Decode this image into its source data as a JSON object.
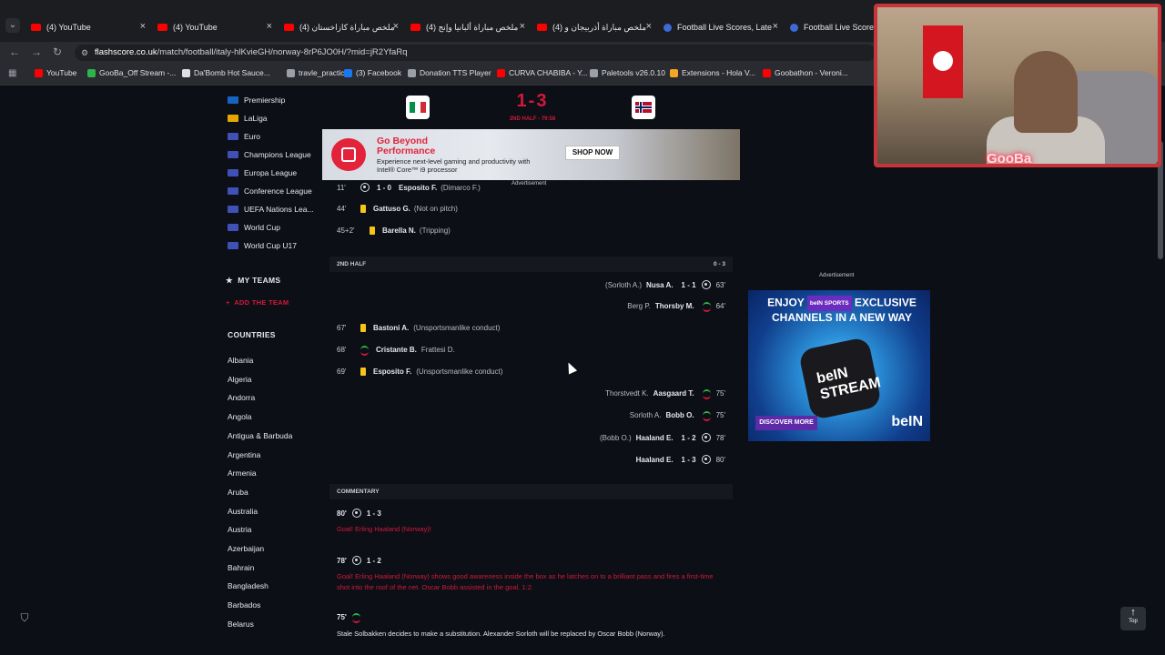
{
  "browser": {
    "tabs": [
      {
        "label": "(4) YouTube",
        "kind": "youtube"
      },
      {
        "label": "(4) YouTube",
        "kind": "youtube"
      },
      {
        "label": "(4) ملخص مباراة كازاخستان",
        "kind": "youtube"
      },
      {
        "label": "(4) ملخص مباراة ألبانيا وإنج",
        "kind": "youtube"
      },
      {
        "label": "(4) ملخص مباراة أذربيجان و",
        "kind": "youtube"
      },
      {
        "label": "Football Live Scores, Late",
        "kind": "flashscore"
      },
      {
        "label": "Football Live Scores, L",
        "kind": "flashscore"
      }
    ],
    "url_host": "flashscore.co.uk",
    "url_path": "/match/football/italy-hlKvieGH/norway-8rP6JO0H/?mid=jR2YfaRq",
    "bookmarks": [
      {
        "label": "YouTube",
        "color": "#ff0000"
      },
      {
        "label": "GooBa_Off Stream -...",
        "color": "#2db34a"
      },
      {
        "label": "Da'Bomb Hot Sauce...",
        "color": "#e0e0e0"
      },
      {
        "label": "travle_practice",
        "color": "#9aa0a6"
      },
      {
        "label": "(3) Facebook",
        "color": "#1877f2"
      },
      {
        "label": "Donation TTS Player",
        "color": "#9aa0a6"
      },
      {
        "label": "CURVA CHABIBA - Y...",
        "color": "#ff0000"
      },
      {
        "label": "Paletools v26.0.10",
        "color": "#9aa0a6"
      },
      {
        "label": "Extensions - Hola V...",
        "color": "#f5a623"
      },
      {
        "label": "Goobathon - Veroni...",
        "color": "#ff0000"
      }
    ]
  },
  "sidebar": {
    "leagues": [
      {
        "label": "Premiership",
        "flag": "#1565c0"
      },
      {
        "label": "LaLiga",
        "flag": "#e6a800"
      },
      {
        "label": "Euro",
        "flag": "#3f51b5"
      },
      {
        "label": "Champions League",
        "flag": "#3f51b5"
      },
      {
        "label": "Europa League",
        "flag": "#3f51b5"
      },
      {
        "label": "Conference League",
        "flag": "#3f51b5"
      },
      {
        "label": "UEFA Nations Lea...",
        "flag": "#3f51b5"
      },
      {
        "label": "World Cup",
        "flag": "#3f51b5"
      },
      {
        "label": "World Cup U17",
        "flag": "#3f51b5"
      }
    ],
    "my_teams_label": "MY TEAMS",
    "add_team_label": "ADD THE TEAM",
    "countries_label": "COUNTRIES",
    "countries": [
      "Albania",
      "Algeria",
      "Andorra",
      "Angola",
      "Antigua & Barbuda",
      "Argentina",
      "Armenia",
      "Aruba",
      "Australia",
      "Austria",
      "Azerbaijan",
      "Bahrain",
      "Bangladesh",
      "Barbados",
      "Belarus"
    ]
  },
  "match": {
    "score": "1-3",
    "status": "2ND HALF - 79:58"
  },
  "ad_top": {
    "headline": "Go Beyond Performance",
    "body": "Experience next-level gaming and productivity with Intel® Core™ i9 processor",
    "cta": "SHOP NOW",
    "label": "Advertisement"
  },
  "first_half_events": [
    {
      "minute": "11'",
      "type": "goal",
      "score": "1 - 0",
      "player": "Esposito F.",
      "detail": "(Dimarco F.)"
    },
    {
      "minute": "44'",
      "type": "yellow",
      "player": "Gattuso G.",
      "detail": "(Not on pitch)"
    },
    {
      "minute": "45+2'",
      "type": "yellow",
      "player": "Barella N.",
      "detail": "(Tripping)"
    }
  ],
  "second_half": {
    "label": "2ND HALF",
    "score": "0 - 3"
  },
  "second_half_events": [
    {
      "side": "away",
      "minute": "63'",
      "type": "goal",
      "score": "1 - 1",
      "player": "Nusa A.",
      "detail": "(Sorloth A.)"
    },
    {
      "side": "away",
      "minute": "64'",
      "type": "sub",
      "player": "Thorsby M.",
      "detail": "Berg P."
    },
    {
      "side": "home",
      "minute": "67'",
      "type": "yellow",
      "player": "Bastoni A.",
      "detail": "(Unsportsmanlike conduct)"
    },
    {
      "side": "home",
      "minute": "68'",
      "type": "sub",
      "player": "Cristante B.",
      "detail": "Frattesi D."
    },
    {
      "side": "home",
      "minute": "69'",
      "type": "yellow",
      "player": "Esposito F.",
      "detail": "(Unsportsmanlike conduct)"
    },
    {
      "side": "away",
      "minute": "75'",
      "type": "sub",
      "player": "Aasgaard T.",
      "detail": "Thorstvedt K."
    },
    {
      "side": "away",
      "minute": "75'",
      "type": "sub",
      "player": "Bobb O.",
      "detail": "Sorloth A."
    },
    {
      "side": "away",
      "minute": "78'",
      "type": "goal",
      "score": "1 - 2",
      "player": "Haaland E.",
      "detail": "(Bobb O.)"
    },
    {
      "side": "away",
      "minute": "80'",
      "type": "goal",
      "score": "1 - 3",
      "player": "Haaland E.",
      "detail": ""
    }
  ],
  "commentary": {
    "label": "COMMENTARY",
    "items": [
      {
        "minute": "80'",
        "type": "goal",
        "score": "1 - 3",
        "text": "Goal! Erling Haaland (Norway)!",
        "highlight": true
      },
      {
        "minute": "78'",
        "type": "goal",
        "score": "1 - 2",
        "text": "Goal! Erling Haaland (Norway) shows good awareness inside the box as he latches on to a brilliant pass and fires a first-time shot into the roof of the net. Oscar Bobb assisted in the goal. 1:2.",
        "highlight": true
      },
      {
        "minute": "75'",
        "type": "sub",
        "score": "",
        "text": "Stale Solbakken decides to make a substitution. Alexander Sorloth will be replaced by Oscar Bobb (Norway).",
        "highlight": false
      }
    ]
  },
  "ad_side": {
    "label": "Advertisement",
    "line1_a": "ENJOY",
    "badge": "beIN SPORTS",
    "line1_b": "EXCLUSIVE",
    "line2": "CHANNELS IN A NEW WAY",
    "device": "beIN STREAM",
    "cta": "DISCOVER MORE",
    "brand": "beIN"
  },
  "webcam": {
    "name": "GooBa"
  },
  "top_button": "Top"
}
